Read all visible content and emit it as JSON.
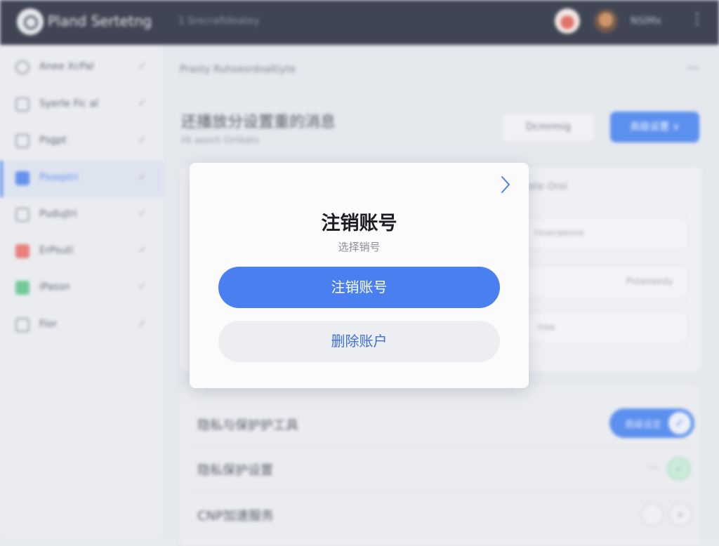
{
  "topbar": {
    "app_title": "Pland Sertetng",
    "breadcrumb": "1 Srecrafideatey",
    "user_name": "NSIMx",
    "menu_glyph": "⋮"
  },
  "sidebar": {
    "items": [
      {
        "label": "Anee XcPal",
        "icon": "globe-icon"
      },
      {
        "label": "Syerle Fic al",
        "icon": "box-icon"
      },
      {
        "label": "Psgpt",
        "icon": "box-icon"
      },
      {
        "label": "Psseptri",
        "icon": "square-icon",
        "active": true
      },
      {
        "label": "Pudujtri",
        "icon": "folder-icon"
      },
      {
        "label": "ErPsuti",
        "icon": "red-square-icon"
      },
      {
        "label": "iPassn",
        "icon": "green-square-icon"
      },
      {
        "label": "Fior",
        "icon": "box-icon"
      }
    ],
    "check_glyph": "✓"
  },
  "main": {
    "breadcrumb": "Prasty Ruhsesrdoaltiyte",
    "title": "还播放分设置重的消息",
    "subtitle": "Ht aesch Orlikets",
    "outline_button": "Dcmrmig",
    "primary_button": "高级设置 ∨"
  },
  "card1": {
    "field_label": "ate Oroi",
    "inputs": [
      "rsseraesne",
      "Pstaeaedy",
      "oaa"
    ]
  },
  "card2": {
    "rows": [
      {
        "label": "隐私与保护护工具",
        "toggle_label": "高级设定",
        "toggle_on": true
      },
      {
        "label": "隐私保护设置"
      },
      {
        "label": "CNP加速服务"
      }
    ]
  },
  "modal": {
    "title": "注销账号",
    "subtitle": "选择销号",
    "primary_button": "注销账号",
    "secondary_button": "删除账户",
    "close_icon": "chevron-right-icon"
  },
  "colors": {
    "accent": "#4a7ff0",
    "topbar": "#1c2333",
    "success": "#5cc58a",
    "danger": "#e86d66"
  }
}
